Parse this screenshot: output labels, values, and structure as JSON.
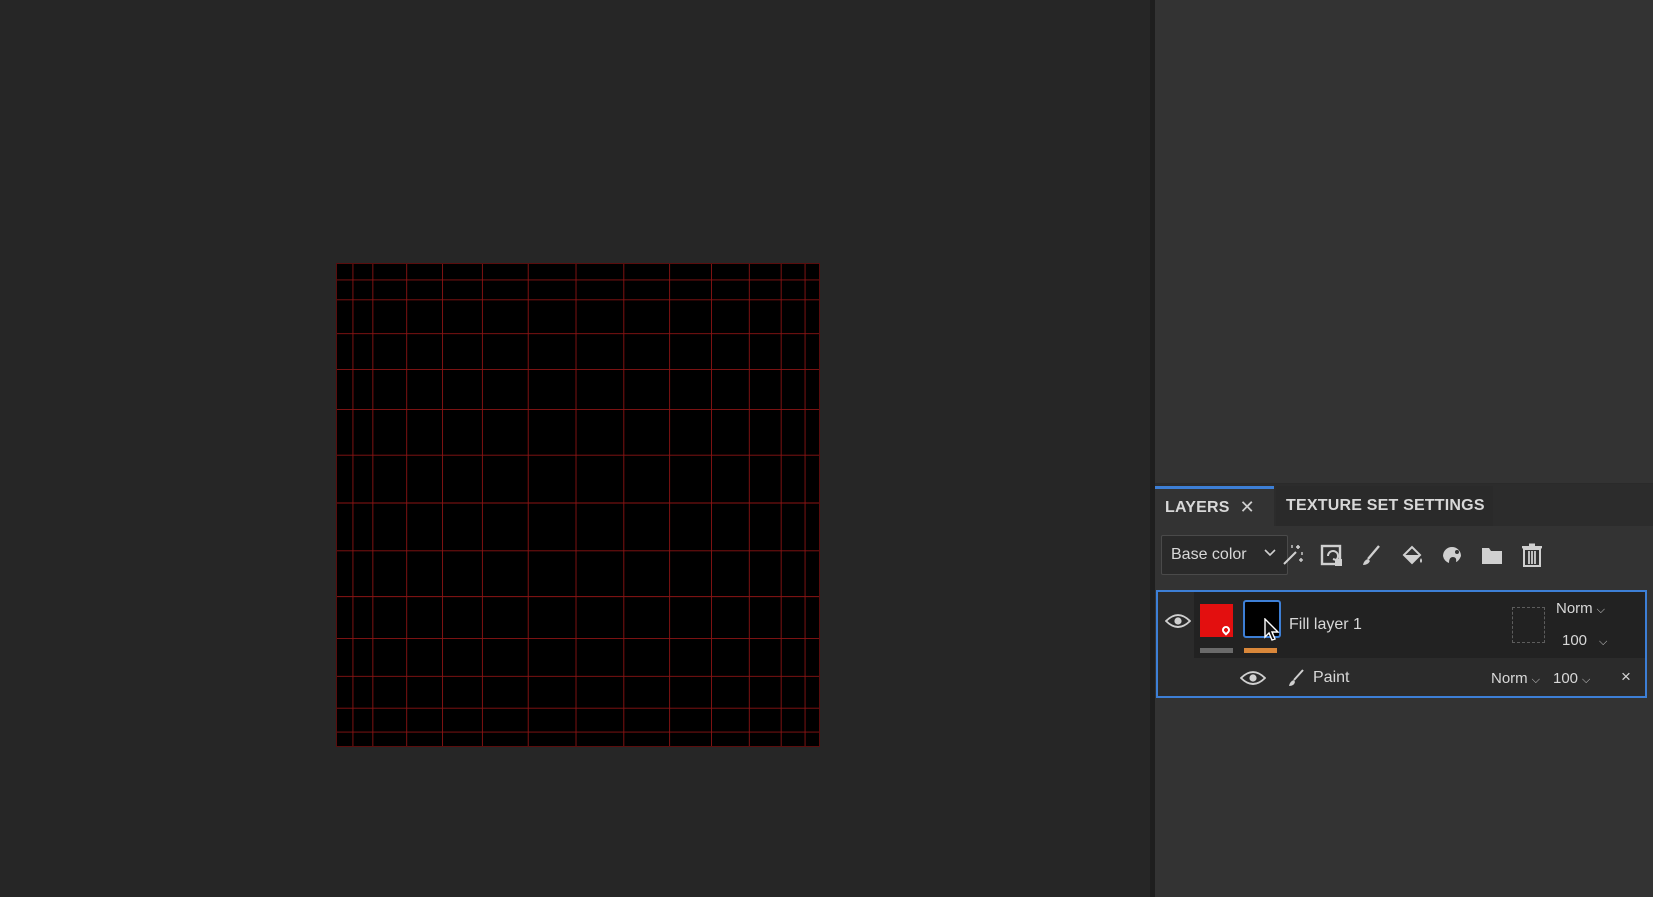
{
  "viewport": {
    "grid_color": "#8b1414",
    "canvas_color": "#000000"
  },
  "layers_panel": {
    "tabs": [
      {
        "label": "LAYERS",
        "active": true
      },
      {
        "label": "TEXTURE SET SETTINGS",
        "active": false
      }
    ],
    "close_glyph": "✕",
    "channel_select": {
      "value": "Base color"
    },
    "toolbar_icons": [
      "magic-wand-icon",
      "add-fill-layer-icon",
      "paint-layer-icon",
      "fill-bucket-icon",
      "smart-mask-icon",
      "folder-icon",
      "delete-icon"
    ],
    "fill_layer": {
      "name": "Fill layer 1",
      "blend_mode": "Norm",
      "opacity": "100",
      "color": "#e30f0f"
    },
    "sub_layer": {
      "name": "Paint",
      "blend_mode": "Norm",
      "opacity": "100",
      "close_glyph": "×"
    },
    "accent_color": "#3d7fd6"
  }
}
